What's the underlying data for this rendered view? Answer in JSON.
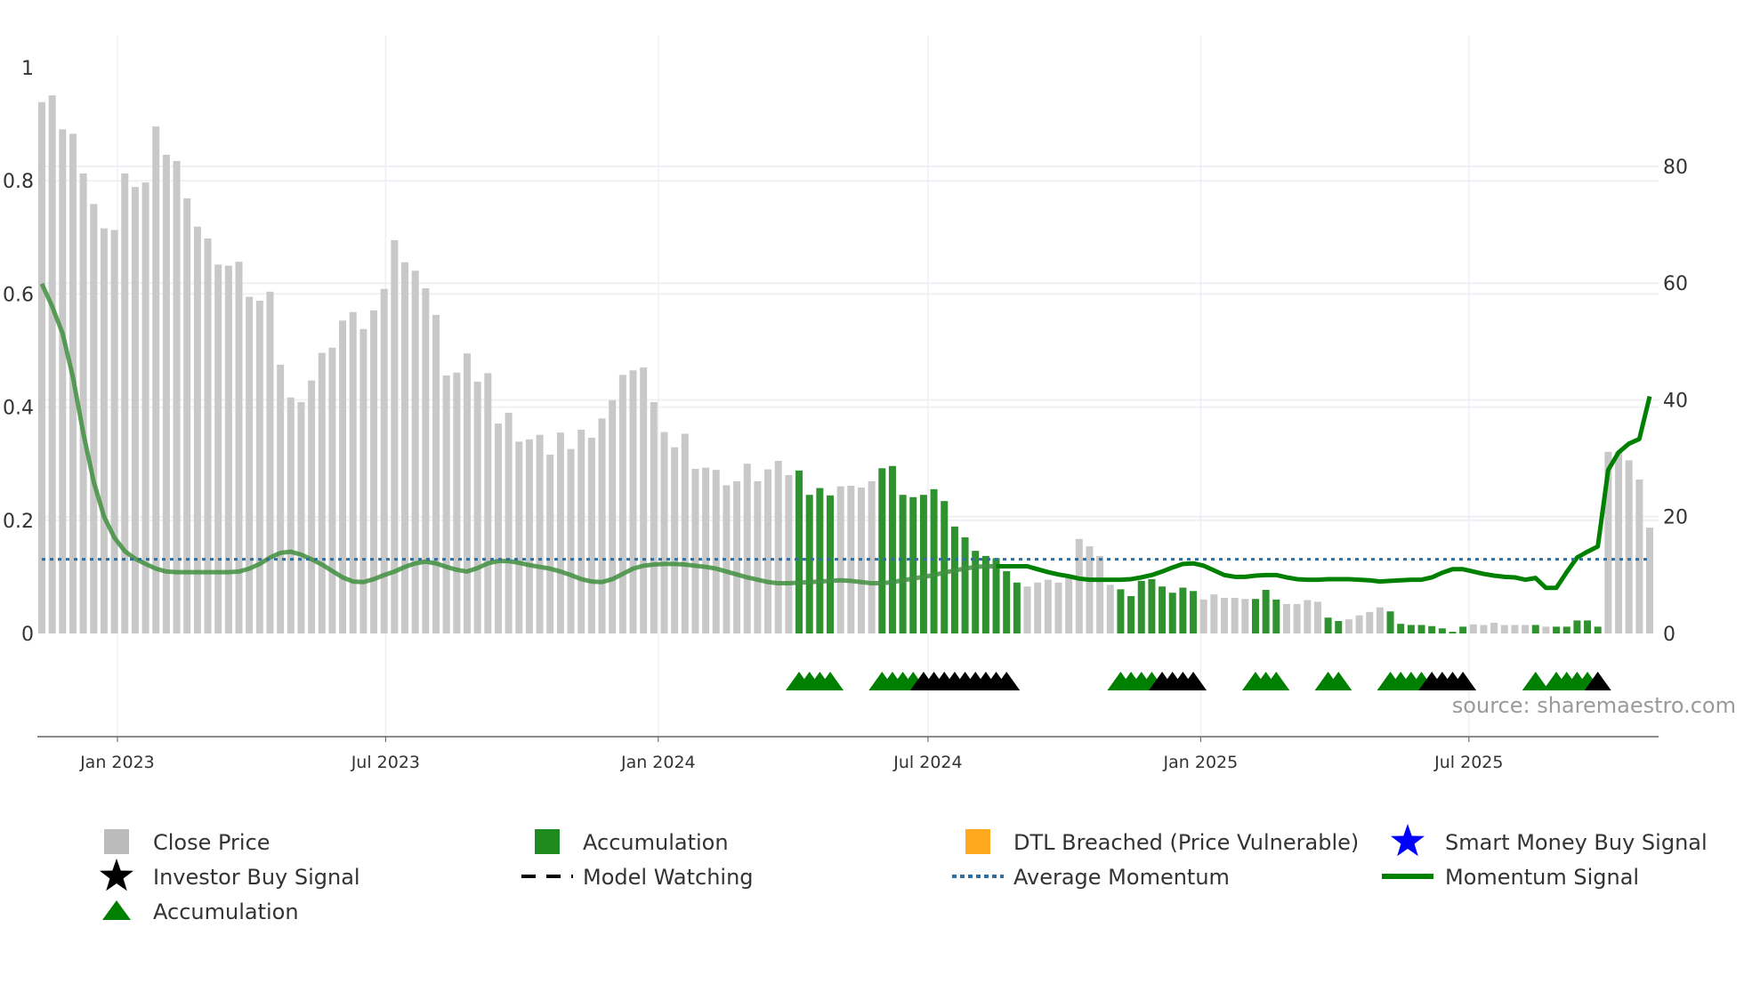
{
  "chart_data": {
    "type": "bar",
    "title": "",
    "xlabel": "",
    "ylabel_left": "",
    "ylabel_right": "",
    "x_range": [
      "2022-11-08",
      "2025-11-06"
    ],
    "ylim_left": [
      0,
      1
    ],
    "ylim_right": [
      0,
      96.6
    ],
    "grid": true,
    "legend_position": "bottom",
    "left_ticks": [
      {
        "v": 1,
        "label": "1"
      },
      {
        "v": 0.8,
        "label": "0.8"
      },
      {
        "v": 0.6,
        "label": "0.6"
      },
      {
        "v": 0.4,
        "label": "0.4"
      },
      {
        "v": 0.2,
        "label": "0.2"
      },
      {
        "v": 0,
        "label": "0"
      }
    ],
    "right_ticks": [
      {
        "v": 80,
        "label": "80"
      },
      {
        "v": 60,
        "label": "60"
      },
      {
        "v": 40,
        "label": "40"
      },
      {
        "v": 20,
        "label": "20"
      },
      {
        "v": 0,
        "label": "0"
      }
    ],
    "x_ticks": [
      {
        "date": "2023-01-01",
        "label": "Jan 2023"
      },
      {
        "date": "2023-07-01",
        "label": "Jul 2023"
      },
      {
        "date": "2024-01-01",
        "label": "Jan 2024"
      },
      {
        "date": "2024-07-01",
        "label": "Jul 2024"
      },
      {
        "date": "2025-01-01",
        "label": "Jan 2025"
      },
      {
        "date": "2025-07-01",
        "label": "Jul 2025"
      }
    ],
    "colors": {
      "close_price": "#c8c8c8",
      "accumulation_bar": "#2f922f",
      "momentum": "#008000",
      "momentum_early": "#3f8f3f",
      "average_momentum": "#2f6f9f",
      "accumulation_marker": "#008000",
      "investor_marker": "#000000",
      "dtl": "#ffa91f",
      "smart_money": "#0000ff"
    },
    "dates": [
      "2022-11-11",
      "2022-11-18",
      "2022-11-25",
      "2022-12-02",
      "2022-12-09",
      "2022-12-16",
      "2022-12-23",
      "2022-12-30",
      "2023-01-06",
      "2023-01-13",
      "2023-01-20",
      "2023-01-27",
      "2023-02-03",
      "2023-02-10",
      "2023-02-17",
      "2023-02-24",
      "2023-03-03",
      "2023-03-10",
      "2023-03-17",
      "2023-03-24",
      "2023-03-31",
      "2023-04-07",
      "2023-04-14",
      "2023-04-21",
      "2023-04-28",
      "2023-05-05",
      "2023-05-12",
      "2023-05-19",
      "2023-05-26",
      "2023-06-02",
      "2023-06-09",
      "2023-06-16",
      "2023-06-23",
      "2023-06-30",
      "2023-07-07",
      "2023-07-14",
      "2023-07-21",
      "2023-07-28",
      "2023-08-04",
      "2023-08-11",
      "2023-08-18",
      "2023-08-25",
      "2023-09-01",
      "2023-09-08",
      "2023-09-15",
      "2023-09-22",
      "2023-09-29",
      "2023-10-06",
      "2023-10-13",
      "2023-10-20",
      "2023-10-27",
      "2023-11-03",
      "2023-11-10",
      "2023-11-17",
      "2023-11-24",
      "2023-12-01",
      "2023-12-08",
      "2023-12-15",
      "2023-12-22",
      "2023-12-29",
      "2024-01-05",
      "2024-01-12",
      "2024-01-19",
      "2024-01-26",
      "2024-02-02",
      "2024-02-09",
      "2024-02-16",
      "2024-02-23",
      "2024-03-01",
      "2024-03-08",
      "2024-03-15",
      "2024-03-22",
      "2024-03-29",
      "2024-04-05",
      "2024-04-12",
      "2024-04-19",
      "2024-04-26",
      "2024-05-03",
      "2024-05-10",
      "2024-05-17",
      "2024-05-24",
      "2024-05-31",
      "2024-06-07",
      "2024-06-14",
      "2024-06-21",
      "2024-06-28",
      "2024-07-05",
      "2024-07-12",
      "2024-07-19",
      "2024-07-26",
      "2024-08-02",
      "2024-08-09",
      "2024-08-16",
      "2024-08-23",
      "2024-08-30",
      "2024-09-06",
      "2024-09-13",
      "2024-09-20",
      "2024-09-27",
      "2024-10-04",
      "2024-10-11",
      "2024-10-18",
      "2024-10-25",
      "2024-11-01",
      "2024-11-08",
      "2024-11-15",
      "2024-11-22",
      "2024-11-29",
      "2024-12-06",
      "2024-12-13",
      "2024-12-20",
      "2024-12-27",
      "2025-01-03",
      "2025-01-10",
      "2025-01-17",
      "2025-01-24",
      "2025-01-31",
      "2025-02-07",
      "2025-02-14",
      "2025-02-21",
      "2025-02-28",
      "2025-03-07",
      "2025-03-14",
      "2025-03-21",
      "2025-03-28",
      "2025-04-04",
      "2025-04-11",
      "2025-04-18",
      "2025-04-25",
      "2025-05-02",
      "2025-05-09",
      "2025-05-16",
      "2025-05-23",
      "2025-05-30",
      "2025-06-06",
      "2025-06-13",
      "2025-06-20",
      "2025-06-27",
      "2025-07-04",
      "2025-07-11",
      "2025-07-18",
      "2025-07-25",
      "2025-08-01",
      "2025-08-08",
      "2025-08-15",
      "2025-08-22",
      "2025-08-29",
      "2025-09-05",
      "2025-09-12",
      "2025-09-19",
      "2025-09-26",
      "2025-10-03",
      "2025-10-10",
      "2025-10-17",
      "2025-10-24",
      "2025-10-31"
    ],
    "close_price": [
      0.939,
      0.951,
      0.891,
      0.883,
      0.813,
      0.759,
      0.716,
      0.713,
      0.813,
      0.789,
      0.797,
      0.896,
      0.846,
      0.835,
      0.769,
      0.719,
      0.698,
      0.652,
      0.65,
      0.657,
      0.595,
      0.588,
      0.604,
      0.475,
      0.417,
      0.409,
      0.447,
      0.496,
      0.505,
      0.553,
      0.568,
      0.538,
      0.571,
      0.609,
      0.695,
      0.656,
      0.641,
      0.61,
      0.563,
      0.456,
      0.461,
      0.495,
      0.445,
      0.46,
      0.371,
      0.39,
      0.339,
      0.343,
      0.351,
      0.316,
      0.355,
      0.326,
      0.36,
      0.346,
      0.38,
      0.412,
      0.457,
      0.465,
      0.47,
      0.409,
      0.356,
      0.329,
      0.353,
      0.291,
      0.293,
      0.289,
      0.262,
      0.269,
      0.3,
      0.269,
      0.29,
      0.305,
      0.28,
      0.288,
      0.245,
      0.257,
      0.244,
      0.26,
      0.261,
      0.258,
      0.269,
      0.292,
      0.296,
      0.245,
      0.241,
      0.245,
      0.255,
      0.234,
      0.189,
      0.17,
      0.146,
      0.137,
      0.133,
      0.11,
      0.09,
      0.083,
      0.09,
      0.095,
      0.09,
      0.098,
      0.167,
      0.154,
      0.137,
      0.086,
      0.078,
      0.066,
      0.093,
      0.096,
      0.083,
      0.072,
      0.081,
      0.075,
      0.06,
      0.069,
      0.063,
      0.063,
      0.061,
      0.061,
      0.077,
      0.06,
      0.052,
      0.052,
      0.059,
      0.056,
      0.028,
      0.022,
      0.025,
      0.032,
      0.038,
      0.046,
      0.039,
      0.017,
      0.015,
      0.015,
      0.013,
      0.009,
      0.003,
      0.012,
      0.016,
      0.015,
      0.019,
      0.015,
      0.015,
      0.015,
      0.015,
      0.012,
      0.012,
      0.012,
      0.023,
      0.023,
      0.012,
      0.321,
      0.321,
      0.306,
      0.272,
      0.187
    ],
    "momentum": [
      59.9,
      56,
      51.4,
      43.9,
      34.3,
      26,
      20,
      16.4,
      14.1,
      12.8,
      11.9,
      11.1,
      10.6,
      10.5,
      10.5,
      10.5,
      10.5,
      10.5,
      10.5,
      10.6,
      11.1,
      11.9,
      13,
      13.8,
      14,
      13.5,
      12.7,
      11.8,
      10.7,
      9.6,
      8.9,
      8.8,
      9.3,
      10,
      10.6,
      11.4,
      12,
      12.3,
      12,
      11.4,
      10.9,
      10.6,
      11.2,
      12,
      12.4,
      12.4,
      12.1,
      11.7,
      11.4,
      11.1,
      10.6,
      10,
      9.3,
      8.9,
      8.8,
      9.3,
      10.2,
      11.1,
      11.6,
      11.8,
      11.9,
      11.9,
      11.8,
      11.6,
      11.4,
      11.1,
      10.6,
      10.1,
      9.6,
      9.2,
      8.8,
      8.6,
      8.6,
      8.7,
      8.8,
      8.9,
      9,
      9.1,
      9,
      8.8,
      8.6,
      8.6,
      8.8,
      9.1,
      9.4,
      9.7,
      10,
      10.4,
      10.8,
      11.1,
      11.4,
      11.5,
      11.5,
      11.5,
      11.5,
      11.5,
      11,
      10.5,
      10.1,
      9.8,
      9.4,
      9.2,
      9.2,
      9.2,
      9.2,
      9.3,
      9.6,
      10,
      10.6,
      11.3,
      11.9,
      12,
      11.6,
      10.8,
      10,
      9.7,
      9.7,
      9.9,
      10,
      10,
      9.6,
      9.3,
      9.2,
      9.2,
      9.3,
      9.3,
      9.3,
      9.2,
      9.1,
      8.9,
      9,
      9.1,
      9.2,
      9.2,
      9.6,
      10.4,
      11,
      11,
      10.6,
      10.2,
      9.9,
      9.7,
      9.6,
      9.2,
      9.5,
      7.8,
      7.8,
      10.5,
      13,
      14,
      14.9,
      28,
      31,
      32.5,
      33.3,
      40.6
    ],
    "average_momentum": 12.7,
    "accumulation_bar_dates": [
      "2024-04-05",
      "2024-04-12",
      "2024-04-19",
      "2024-04-26",
      "2024-05-31",
      "2024-06-07",
      "2024-06-14",
      "2024-06-21",
      "2024-06-28",
      "2024-07-05",
      "2024-07-12",
      "2024-07-19",
      "2024-07-26",
      "2024-08-02",
      "2024-08-09",
      "2024-08-16",
      "2024-08-23",
      "2024-08-30",
      "2024-11-08",
      "2024-11-15",
      "2024-11-22",
      "2024-11-29",
      "2024-12-06",
      "2024-12-13",
      "2024-12-20",
      "2024-12-27",
      "2025-02-07",
      "2025-02-14",
      "2025-02-21",
      "2025-03-28",
      "2025-04-04",
      "2025-05-09",
      "2025-05-16",
      "2025-05-23",
      "2025-05-30",
      "2025-06-06",
      "2025-06-13",
      "2025-06-20",
      "2025-06-27",
      "2025-08-15",
      "2025-08-29",
      "2025-09-05",
      "2025-09-12",
      "2025-09-19",
      "2025-09-26"
    ],
    "green_triangle_dates": [
      "2024-04-05",
      "2024-04-12",
      "2024-04-19",
      "2024-04-26",
      "2024-05-31",
      "2024-06-07",
      "2024-06-14",
      "2024-06-21",
      "2024-11-08",
      "2024-11-15",
      "2024-11-22",
      "2024-11-29",
      "2025-02-07",
      "2025-02-14",
      "2025-02-21",
      "2025-03-28",
      "2025-04-04",
      "2025-05-09",
      "2025-05-16",
      "2025-05-23",
      "2025-05-30",
      "2025-08-15",
      "2025-08-29",
      "2025-09-05",
      "2025-09-12",
      "2025-09-19"
    ],
    "black_triangle_dates": [
      "2024-06-28",
      "2024-07-05",
      "2024-07-12",
      "2024-07-19",
      "2024-07-26",
      "2024-08-02",
      "2024-08-09",
      "2024-08-16",
      "2024-08-23",
      "2024-12-06",
      "2024-12-13",
      "2024-12-20",
      "2024-12-27",
      "2025-06-06",
      "2025-06-13",
      "2025-06-20",
      "2025-06-27",
      "2025-09-26"
    ]
  },
  "legend": [
    {
      "label": "Close Price",
      "icon": "gray-square"
    },
    {
      "label": "Accumulation",
      "icon": "green-square"
    },
    {
      "label": "DTL Breached (Price Vulnerable)",
      "icon": "orange-square"
    },
    {
      "label": "Smart Money Buy Signal",
      "icon": "blue-star"
    },
    {
      "label": "Investor Buy Signal",
      "icon": "black-star"
    },
    {
      "label": "Model Watching",
      "icon": "black-dashed-line"
    },
    {
      "label": "Average Momentum",
      "icon": "blue-dotted-line"
    },
    {
      "label": "Momentum Signal",
      "icon": "green-line"
    },
    {
      "label": "Accumulation",
      "icon": "green-triangle"
    }
  ],
  "source": "source: sharemaestro.com"
}
